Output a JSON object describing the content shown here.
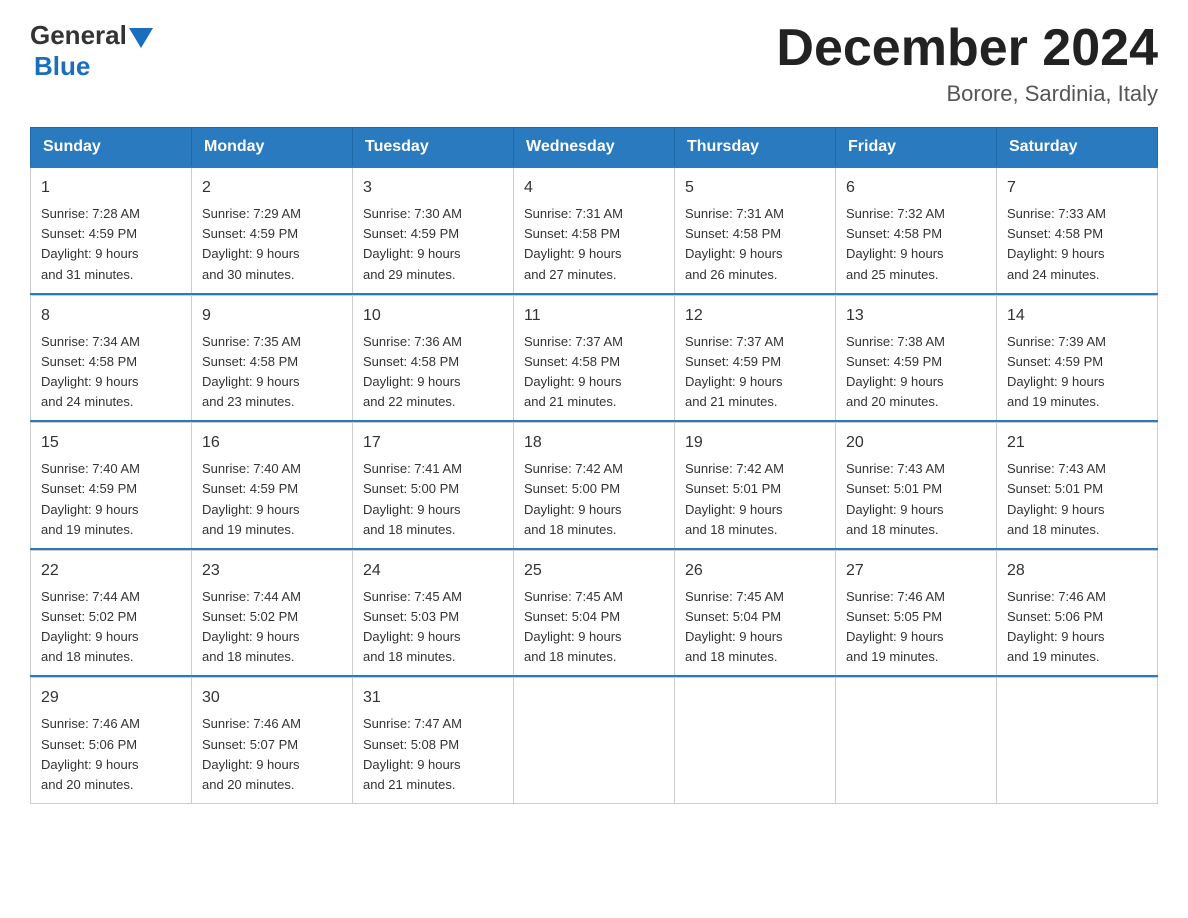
{
  "logo": {
    "general": "General",
    "blue": "Blue"
  },
  "title": {
    "month_year": "December 2024",
    "location": "Borore, Sardinia, Italy"
  },
  "weekdays": [
    "Sunday",
    "Monday",
    "Tuesday",
    "Wednesday",
    "Thursday",
    "Friday",
    "Saturday"
  ],
  "weeks": [
    [
      {
        "day": "1",
        "sunrise": "7:28 AM",
        "sunset": "4:59 PM",
        "daylight": "9 hours and 31 minutes."
      },
      {
        "day": "2",
        "sunrise": "7:29 AM",
        "sunset": "4:59 PM",
        "daylight": "9 hours and 30 minutes."
      },
      {
        "day": "3",
        "sunrise": "7:30 AM",
        "sunset": "4:59 PM",
        "daylight": "9 hours and 29 minutes."
      },
      {
        "day": "4",
        "sunrise": "7:31 AM",
        "sunset": "4:58 PM",
        "daylight": "9 hours and 27 minutes."
      },
      {
        "day": "5",
        "sunrise": "7:31 AM",
        "sunset": "4:58 PM",
        "daylight": "9 hours and 26 minutes."
      },
      {
        "day": "6",
        "sunrise": "7:32 AM",
        "sunset": "4:58 PM",
        "daylight": "9 hours and 25 minutes."
      },
      {
        "day": "7",
        "sunrise": "7:33 AM",
        "sunset": "4:58 PM",
        "daylight": "9 hours and 24 minutes."
      }
    ],
    [
      {
        "day": "8",
        "sunrise": "7:34 AM",
        "sunset": "4:58 PM",
        "daylight": "9 hours and 24 minutes."
      },
      {
        "day": "9",
        "sunrise": "7:35 AM",
        "sunset": "4:58 PM",
        "daylight": "9 hours and 23 minutes."
      },
      {
        "day": "10",
        "sunrise": "7:36 AM",
        "sunset": "4:58 PM",
        "daylight": "9 hours and 22 minutes."
      },
      {
        "day": "11",
        "sunrise": "7:37 AM",
        "sunset": "4:58 PM",
        "daylight": "9 hours and 21 minutes."
      },
      {
        "day": "12",
        "sunrise": "7:37 AM",
        "sunset": "4:59 PM",
        "daylight": "9 hours and 21 minutes."
      },
      {
        "day": "13",
        "sunrise": "7:38 AM",
        "sunset": "4:59 PM",
        "daylight": "9 hours and 20 minutes."
      },
      {
        "day": "14",
        "sunrise": "7:39 AM",
        "sunset": "4:59 PM",
        "daylight": "9 hours and 19 minutes."
      }
    ],
    [
      {
        "day": "15",
        "sunrise": "7:40 AM",
        "sunset": "4:59 PM",
        "daylight": "9 hours and 19 minutes."
      },
      {
        "day": "16",
        "sunrise": "7:40 AM",
        "sunset": "4:59 PM",
        "daylight": "9 hours and 19 minutes."
      },
      {
        "day": "17",
        "sunrise": "7:41 AM",
        "sunset": "5:00 PM",
        "daylight": "9 hours and 18 minutes."
      },
      {
        "day": "18",
        "sunrise": "7:42 AM",
        "sunset": "5:00 PM",
        "daylight": "9 hours and 18 minutes."
      },
      {
        "day": "19",
        "sunrise": "7:42 AM",
        "sunset": "5:01 PM",
        "daylight": "9 hours and 18 minutes."
      },
      {
        "day": "20",
        "sunrise": "7:43 AM",
        "sunset": "5:01 PM",
        "daylight": "9 hours and 18 minutes."
      },
      {
        "day": "21",
        "sunrise": "7:43 AM",
        "sunset": "5:01 PM",
        "daylight": "9 hours and 18 minutes."
      }
    ],
    [
      {
        "day": "22",
        "sunrise": "7:44 AM",
        "sunset": "5:02 PM",
        "daylight": "9 hours and 18 minutes."
      },
      {
        "day": "23",
        "sunrise": "7:44 AM",
        "sunset": "5:02 PM",
        "daylight": "9 hours and 18 minutes."
      },
      {
        "day": "24",
        "sunrise": "7:45 AM",
        "sunset": "5:03 PM",
        "daylight": "9 hours and 18 minutes."
      },
      {
        "day": "25",
        "sunrise": "7:45 AM",
        "sunset": "5:04 PM",
        "daylight": "9 hours and 18 minutes."
      },
      {
        "day": "26",
        "sunrise": "7:45 AM",
        "sunset": "5:04 PM",
        "daylight": "9 hours and 18 minutes."
      },
      {
        "day": "27",
        "sunrise": "7:46 AM",
        "sunset": "5:05 PM",
        "daylight": "9 hours and 19 minutes."
      },
      {
        "day": "28",
        "sunrise": "7:46 AM",
        "sunset": "5:06 PM",
        "daylight": "9 hours and 19 minutes."
      }
    ],
    [
      {
        "day": "29",
        "sunrise": "7:46 AM",
        "sunset": "5:06 PM",
        "daylight": "9 hours and 20 minutes."
      },
      {
        "day": "30",
        "sunrise": "7:46 AM",
        "sunset": "5:07 PM",
        "daylight": "9 hours and 20 minutes."
      },
      {
        "day": "31",
        "sunrise": "7:47 AM",
        "sunset": "5:08 PM",
        "daylight": "9 hours and 21 minutes."
      },
      null,
      null,
      null,
      null
    ]
  ],
  "labels": {
    "sunrise": "Sunrise:",
    "sunset": "Sunset:",
    "daylight": "Daylight:"
  }
}
